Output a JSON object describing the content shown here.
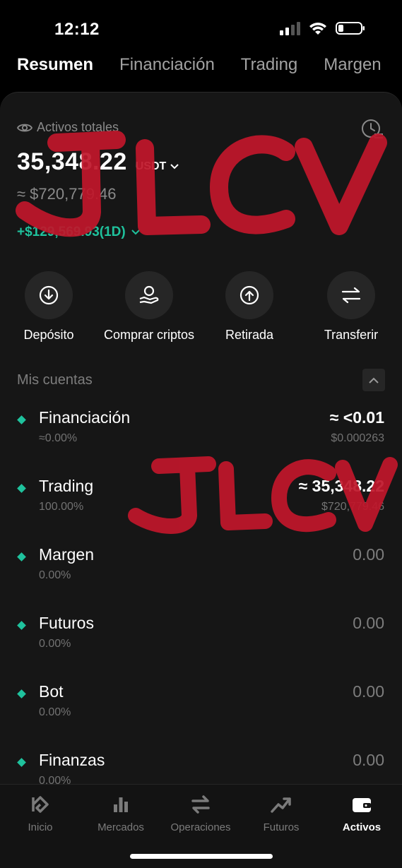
{
  "status_bar": {
    "time": "12:12"
  },
  "top_tabs": [
    {
      "label": "Resumen",
      "active": true
    },
    {
      "label": "Financiación",
      "active": false
    },
    {
      "label": "Trading",
      "active": false
    },
    {
      "label": "Margen",
      "active": false
    }
  ],
  "summary": {
    "label": "Activos totales",
    "total": "35,348.22",
    "unit": "USDT",
    "fiat": "≈ $720,779.46",
    "pnl": "+$129,569.93(1D)"
  },
  "actions": [
    {
      "label": "Depósito",
      "icon": "download-icon"
    },
    {
      "label": "Comprar criptos",
      "icon": "hand-coin-icon"
    },
    {
      "label": "Retirada",
      "icon": "upload-icon"
    },
    {
      "label": "Transferir",
      "icon": "transfer-icon"
    }
  ],
  "accounts_section": {
    "title": "Mis cuentas"
  },
  "accounts": [
    {
      "name": "Financiación",
      "pct": "≈0.00%",
      "value": "≈ <0.01",
      "fiat": "$0.000263"
    },
    {
      "name": "Trading",
      "pct": "100.00%",
      "value": "≈ 35,348.22",
      "fiat": "$720,779.46"
    },
    {
      "name": "Margen",
      "pct": "0.00%",
      "value": "0.00",
      "fiat": ""
    },
    {
      "name": "Futuros",
      "pct": "0.00%",
      "value": "0.00",
      "fiat": ""
    },
    {
      "name": "Bot",
      "pct": "0.00%",
      "value": "0.00",
      "fiat": ""
    },
    {
      "name": "Finanzas",
      "pct": "0.00%",
      "value": "0.00",
      "fiat": ""
    }
  ],
  "bottom_nav": [
    {
      "label": "Inicio",
      "icon": "home-logo-icon",
      "active": false
    },
    {
      "label": "Mercados",
      "icon": "bar-chart-icon",
      "active": false
    },
    {
      "label": "Operaciones",
      "icon": "swap-icon",
      "active": false
    },
    {
      "label": "Futuros",
      "icon": "trend-up-icon",
      "active": false
    },
    {
      "label": "Activos",
      "icon": "wallet-icon",
      "active": true
    }
  ],
  "watermark": {
    "text": "JLCV",
    "color": "#c0172b"
  },
  "colors": {
    "accent_green": "#1fc29d",
    "background": "#161616"
  }
}
